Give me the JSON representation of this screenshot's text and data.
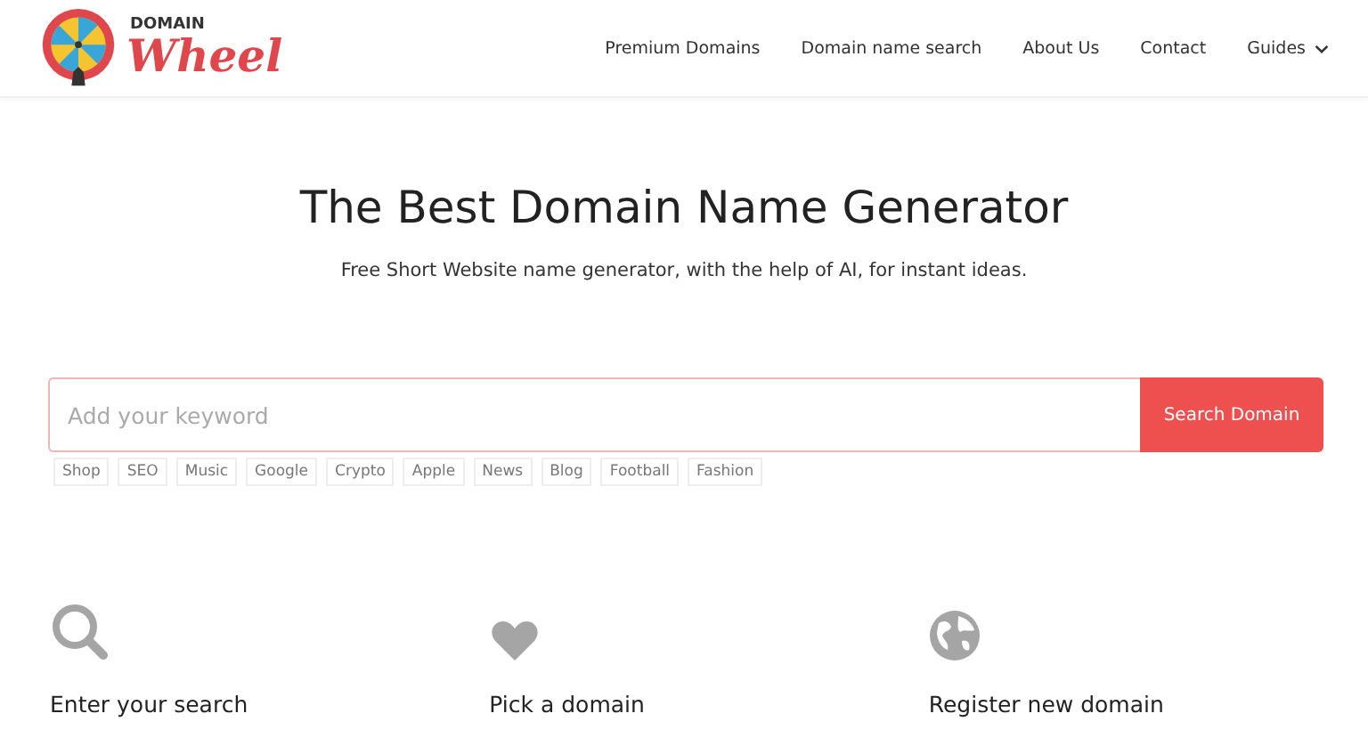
{
  "logo": {
    "top": "DOMAIN",
    "bottom": "Wheel"
  },
  "nav": [
    {
      "label": "Premium Domains",
      "dropdown": false
    },
    {
      "label": "Domain name search",
      "dropdown": false
    },
    {
      "label": "About Us",
      "dropdown": false
    },
    {
      "label": "Contact",
      "dropdown": false
    },
    {
      "label": "Guides",
      "dropdown": true
    }
  ],
  "hero": {
    "title": "The Best Domain Name Generator",
    "subtitle": "Free Short Website name generator, with the help of AI, for instant ideas."
  },
  "search": {
    "placeholder": "Add your keyword",
    "button": "Search Domain"
  },
  "tags": [
    "Shop",
    "SEO",
    "Music",
    "Google",
    "Crypto",
    "Apple",
    "News",
    "Blog",
    "Football",
    "Fashion"
  ],
  "steps": [
    {
      "kind": "search",
      "label": "Enter your search"
    },
    {
      "kind": "heart",
      "label": "Pick a domain"
    },
    {
      "kind": "globe",
      "label": "Register new domain"
    }
  ]
}
